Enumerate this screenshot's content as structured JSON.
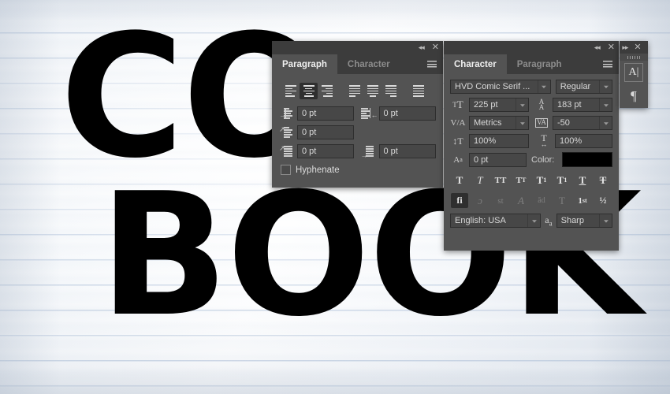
{
  "canvas": {
    "artwork_lines": [
      "CO",
      "BOOK"
    ],
    "background": "lined-notebook-paper",
    "paper_color": "#f3f6fa",
    "rule_line_color": "#8ca5c8",
    "text_color": "#000000"
  },
  "paragraph_panel": {
    "titlebar": {
      "collapse_label": "◂◂",
      "close_label": "✕"
    },
    "tabs": [
      {
        "label": "Paragraph",
        "active": true
      },
      {
        "label": "Character",
        "active": false
      }
    ],
    "menu_icon": "hamburger-menu-icon",
    "alignment": {
      "options": [
        "align-left",
        "align-center",
        "align-right",
        "justify-last-left",
        "justify-last-center",
        "justify-last-right",
        "justify-all"
      ],
      "selected": "align-center"
    },
    "fields": [
      {
        "name": "indent-left-margin",
        "icon": "indent-left-icon",
        "value": "0 pt"
      },
      {
        "name": "indent-right-margin",
        "icon": "indent-right-icon",
        "value": "0 pt"
      },
      {
        "name": "indent-first-line",
        "icon": "indent-first-line-icon",
        "value": "0 pt"
      },
      {
        "name": "space-before",
        "icon": "space-before-icon",
        "value": "0 pt"
      },
      {
        "name": "space-after",
        "icon": "space-after-icon",
        "value": "0 pt"
      }
    ],
    "hyphenate": {
      "label": "Hyphenate",
      "checked": false
    }
  },
  "character_panel": {
    "titlebar": {
      "collapse_label": "◂◂",
      "close_label": "✕"
    },
    "tabs": [
      {
        "label": "Character",
        "active": true
      },
      {
        "label": "Paragraph",
        "active": false
      }
    ],
    "menu_icon": "hamburger-menu-icon",
    "font_family": "HVD Comic Serif ...",
    "font_style": "Regular",
    "font_size": "225 pt",
    "leading": "183 pt",
    "kerning": "Metrics",
    "tracking": "-50",
    "vertical_scale": "100%",
    "horizontal_scale": "100%",
    "baseline_shift": "0 pt",
    "color_label": "Color:",
    "color_value": "#000000",
    "style_buttons": [
      {
        "name": "faux-bold",
        "glyph": "T",
        "enabled": true
      },
      {
        "name": "faux-italic",
        "glyph": "T",
        "enabled": false
      },
      {
        "name": "all-caps",
        "glyph": "TT",
        "enabled": false
      },
      {
        "name": "small-caps",
        "glyph": "Tr",
        "enabled": false
      },
      {
        "name": "superscript",
        "glyph": "T1",
        "enabled": false
      },
      {
        "name": "subscript",
        "glyph": "T1",
        "enabled": false
      },
      {
        "name": "underline",
        "glyph": "T",
        "enabled": false
      },
      {
        "name": "strikethrough",
        "glyph": "T",
        "enabled": false
      }
    ],
    "opentype_buttons": [
      {
        "name": "standard-ligatures",
        "glyph": "fi",
        "active": true
      },
      {
        "name": "contextual-alternates",
        "glyph": "ɔ",
        "active": false
      },
      {
        "name": "discretionary-ligatures",
        "glyph": "st",
        "active": false
      },
      {
        "name": "swash",
        "glyph": "A",
        "active": false
      },
      {
        "name": "oldstyle",
        "glyph": "ad",
        "active": false
      },
      {
        "name": "stylistic-alternates",
        "glyph": "T",
        "active": false
      },
      {
        "name": "ordinals",
        "glyph": "1st",
        "active": false
      },
      {
        "name": "fractions",
        "glyph": "½",
        "active": false
      }
    ],
    "language": "English: USA",
    "anti_aliasing_icon": "anti-alias-icon",
    "anti_aliasing": "Sharp"
  },
  "dock_panel": {
    "expand_label": "▸▸",
    "close_label": "✕",
    "buttons": [
      {
        "name": "character-panel-icon",
        "glyph": "A|"
      },
      {
        "name": "paragraph-panel-icon",
        "glyph": "¶"
      }
    ]
  }
}
